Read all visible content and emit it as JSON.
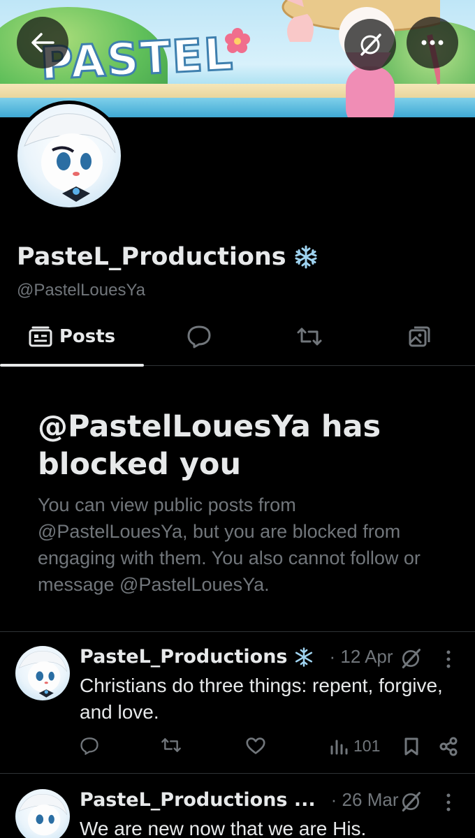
{
  "banner": {
    "wordmark": "PASTEL"
  },
  "profile": {
    "name": "PasteL_Productions",
    "badge_icon": "snowflake-icon",
    "handle": "@PastelLouesYa"
  },
  "tabs": [
    {
      "label": "Posts",
      "icon": "posts-icon",
      "active": true
    },
    {
      "label": "",
      "icon": "replies-icon"
    },
    {
      "label": "",
      "icon": "repost-icon"
    },
    {
      "label": "",
      "icon": "media-icon"
    }
  ],
  "blocked": {
    "title": "@PastelLouesYa has blocked you",
    "description": "You can view public posts from @PastelLouesYa, but you are blocked from engaging with them. You also cannot follow or message @PastelLouesYa."
  },
  "posts": [
    {
      "author": "PasteL_Productions",
      "badge_icon": "snowflake-icon",
      "date": "· 12 Apr",
      "text": "Christians do three things: repent, forgive, and love.",
      "views": "101"
    },
    {
      "author": "PasteL_Productions ...",
      "date": "· 26 Mar",
      "text": "We are new now that we are His."
    }
  ],
  "colors": {
    "background": "#000000",
    "primary_text": "#e7e9ea",
    "secondary_text": "#71767b",
    "divider": "#2f3336",
    "badge": "#9fd3f0"
  }
}
